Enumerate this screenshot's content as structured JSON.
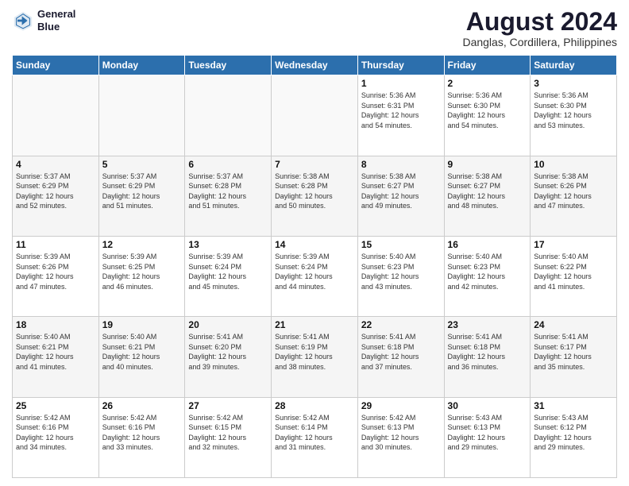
{
  "logo": {
    "line1": "General",
    "line2": "Blue"
  },
  "title": "August 2024",
  "location": "Danglas, Cordillera, Philippines",
  "headers": [
    "Sunday",
    "Monday",
    "Tuesday",
    "Wednesday",
    "Thursday",
    "Friday",
    "Saturday"
  ],
  "weeks": [
    [
      {
        "day": "",
        "info": ""
      },
      {
        "day": "",
        "info": ""
      },
      {
        "day": "",
        "info": ""
      },
      {
        "day": "",
        "info": ""
      },
      {
        "day": "1",
        "info": "Sunrise: 5:36 AM\nSunset: 6:31 PM\nDaylight: 12 hours\nand 54 minutes."
      },
      {
        "day": "2",
        "info": "Sunrise: 5:36 AM\nSunset: 6:30 PM\nDaylight: 12 hours\nand 54 minutes."
      },
      {
        "day": "3",
        "info": "Sunrise: 5:36 AM\nSunset: 6:30 PM\nDaylight: 12 hours\nand 53 minutes."
      }
    ],
    [
      {
        "day": "4",
        "info": "Sunrise: 5:37 AM\nSunset: 6:29 PM\nDaylight: 12 hours\nand 52 minutes."
      },
      {
        "day": "5",
        "info": "Sunrise: 5:37 AM\nSunset: 6:29 PM\nDaylight: 12 hours\nand 51 minutes."
      },
      {
        "day": "6",
        "info": "Sunrise: 5:37 AM\nSunset: 6:28 PM\nDaylight: 12 hours\nand 51 minutes."
      },
      {
        "day": "7",
        "info": "Sunrise: 5:38 AM\nSunset: 6:28 PM\nDaylight: 12 hours\nand 50 minutes."
      },
      {
        "day": "8",
        "info": "Sunrise: 5:38 AM\nSunset: 6:27 PM\nDaylight: 12 hours\nand 49 minutes."
      },
      {
        "day": "9",
        "info": "Sunrise: 5:38 AM\nSunset: 6:27 PM\nDaylight: 12 hours\nand 48 minutes."
      },
      {
        "day": "10",
        "info": "Sunrise: 5:38 AM\nSunset: 6:26 PM\nDaylight: 12 hours\nand 47 minutes."
      }
    ],
    [
      {
        "day": "11",
        "info": "Sunrise: 5:39 AM\nSunset: 6:26 PM\nDaylight: 12 hours\nand 47 minutes."
      },
      {
        "day": "12",
        "info": "Sunrise: 5:39 AM\nSunset: 6:25 PM\nDaylight: 12 hours\nand 46 minutes."
      },
      {
        "day": "13",
        "info": "Sunrise: 5:39 AM\nSunset: 6:24 PM\nDaylight: 12 hours\nand 45 minutes."
      },
      {
        "day": "14",
        "info": "Sunrise: 5:39 AM\nSunset: 6:24 PM\nDaylight: 12 hours\nand 44 minutes."
      },
      {
        "day": "15",
        "info": "Sunrise: 5:40 AM\nSunset: 6:23 PM\nDaylight: 12 hours\nand 43 minutes."
      },
      {
        "day": "16",
        "info": "Sunrise: 5:40 AM\nSunset: 6:23 PM\nDaylight: 12 hours\nand 42 minutes."
      },
      {
        "day": "17",
        "info": "Sunrise: 5:40 AM\nSunset: 6:22 PM\nDaylight: 12 hours\nand 41 minutes."
      }
    ],
    [
      {
        "day": "18",
        "info": "Sunrise: 5:40 AM\nSunset: 6:21 PM\nDaylight: 12 hours\nand 41 minutes."
      },
      {
        "day": "19",
        "info": "Sunrise: 5:40 AM\nSunset: 6:21 PM\nDaylight: 12 hours\nand 40 minutes."
      },
      {
        "day": "20",
        "info": "Sunrise: 5:41 AM\nSunset: 6:20 PM\nDaylight: 12 hours\nand 39 minutes."
      },
      {
        "day": "21",
        "info": "Sunrise: 5:41 AM\nSunset: 6:19 PM\nDaylight: 12 hours\nand 38 minutes."
      },
      {
        "day": "22",
        "info": "Sunrise: 5:41 AM\nSunset: 6:18 PM\nDaylight: 12 hours\nand 37 minutes."
      },
      {
        "day": "23",
        "info": "Sunrise: 5:41 AM\nSunset: 6:18 PM\nDaylight: 12 hours\nand 36 minutes."
      },
      {
        "day": "24",
        "info": "Sunrise: 5:41 AM\nSunset: 6:17 PM\nDaylight: 12 hours\nand 35 minutes."
      }
    ],
    [
      {
        "day": "25",
        "info": "Sunrise: 5:42 AM\nSunset: 6:16 PM\nDaylight: 12 hours\nand 34 minutes."
      },
      {
        "day": "26",
        "info": "Sunrise: 5:42 AM\nSunset: 6:16 PM\nDaylight: 12 hours\nand 33 minutes."
      },
      {
        "day": "27",
        "info": "Sunrise: 5:42 AM\nSunset: 6:15 PM\nDaylight: 12 hours\nand 32 minutes."
      },
      {
        "day": "28",
        "info": "Sunrise: 5:42 AM\nSunset: 6:14 PM\nDaylight: 12 hours\nand 31 minutes."
      },
      {
        "day": "29",
        "info": "Sunrise: 5:42 AM\nSunset: 6:13 PM\nDaylight: 12 hours\nand 30 minutes."
      },
      {
        "day": "30",
        "info": "Sunrise: 5:43 AM\nSunset: 6:13 PM\nDaylight: 12 hours\nand 29 minutes."
      },
      {
        "day": "31",
        "info": "Sunrise: 5:43 AM\nSunset: 6:12 PM\nDaylight: 12 hours\nand 29 minutes."
      }
    ]
  ]
}
